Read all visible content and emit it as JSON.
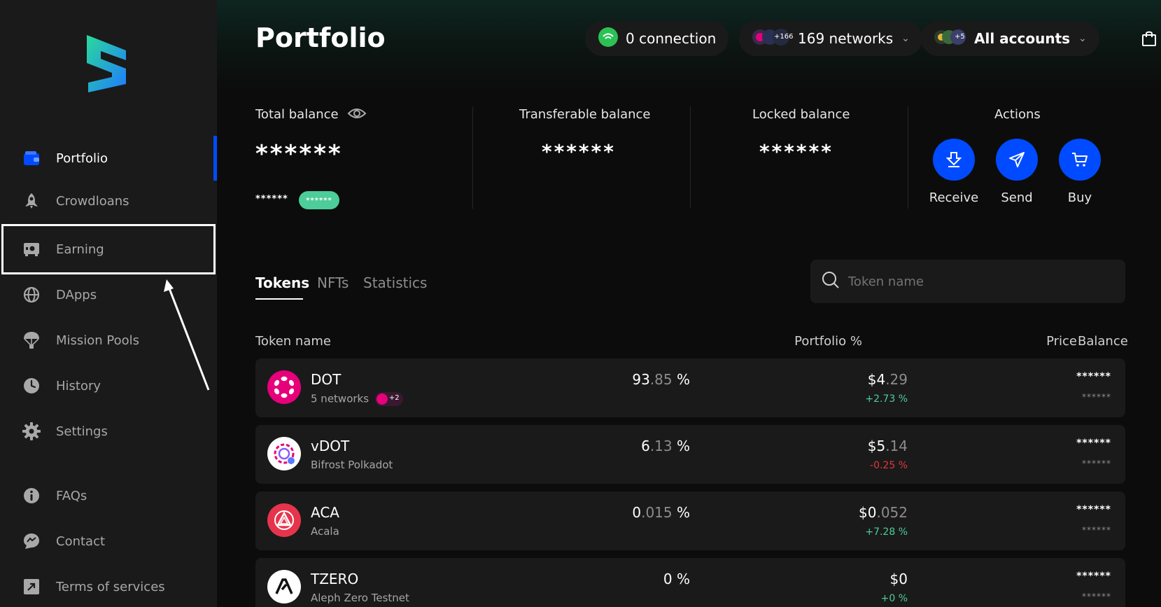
{
  "app": {
    "name": "SubWallet"
  },
  "sidebar": {
    "items": [
      {
        "label": "Portfolio",
        "icon": "wallet-icon"
      },
      {
        "label": "Crowdloans",
        "icon": "rocket-icon"
      },
      {
        "label": "Earning",
        "icon": "safe-icon"
      },
      {
        "label": "DApps",
        "icon": "globe-icon"
      },
      {
        "label": "Mission Pools",
        "icon": "parachute-icon"
      },
      {
        "label": "History",
        "icon": "clock-icon"
      },
      {
        "label": "Settings",
        "icon": "gear-icon"
      },
      {
        "label": "FAQs",
        "icon": "info-icon"
      },
      {
        "label": "Contact",
        "icon": "chat-icon"
      },
      {
        "label": "Terms of services",
        "icon": "external-link-icon"
      }
    ],
    "active": "Portfolio"
  },
  "header": {
    "title": "Portfolio",
    "connection": "0 connection",
    "networks": "169 networks",
    "networks_badge": "+166",
    "accounts": "All accounts",
    "accounts_badge": "+5"
  },
  "balances": {
    "total_label": "Total balance",
    "total_value": "******",
    "total_sub": "******",
    "total_badge": "******",
    "transferable_label": "Transferable balance",
    "transferable_value": "******",
    "locked_label": "Locked balance",
    "locked_value": "******",
    "actions_label": "Actions",
    "actions": [
      "Receive",
      "Send",
      "Buy"
    ]
  },
  "tabs": [
    "Tokens",
    "NFTs",
    "Statistics"
  ],
  "active_tab": "Tokens",
  "search": {
    "placeholder": "Token name"
  },
  "table": {
    "headers": [
      "Token name",
      "Portfolio %",
      "Price",
      "Balance"
    ],
    "rows": [
      {
        "name": "DOT",
        "sub": "5 networks",
        "sub_badge": "+2",
        "pct_int": "93",
        "pct_dec": ".85",
        "pct_unit": " %",
        "price_int": "$4",
        "price_dec": ".29",
        "change": "+2.73 %",
        "change_dir": "up",
        "bal": "******",
        "bal_sub": "******"
      },
      {
        "name": "vDOT",
        "sub": "Bifrost Polkadot",
        "pct_int": "6",
        "pct_dec": ".13",
        "pct_unit": " %",
        "price_int": "$5",
        "price_dec": ".14",
        "change": "-0.25 %",
        "change_dir": "down",
        "bal": "******",
        "bal_sub": "******"
      },
      {
        "name": "ACA",
        "sub": "Acala",
        "pct_int": "0",
        "pct_dec": ".015",
        "pct_unit": " %",
        "price_int": "$0",
        "price_dec": ".052",
        "change": "+7.28 %",
        "change_dir": "up",
        "bal": "******",
        "bal_sub": "******"
      },
      {
        "name": "TZERO",
        "sub": "Aleph Zero Testnet",
        "pct_int": "0",
        "pct_dec": "",
        "pct_unit": " %",
        "price_int": "$0",
        "price_dec": "",
        "change": "+0 %",
        "change_dir": "up",
        "bal": "******",
        "bal_sub": "******"
      }
    ]
  },
  "colors": {
    "accent": "#004bff",
    "positive": "#4ccd99",
    "negative": "#e6353d",
    "dot": "#e6007a"
  }
}
